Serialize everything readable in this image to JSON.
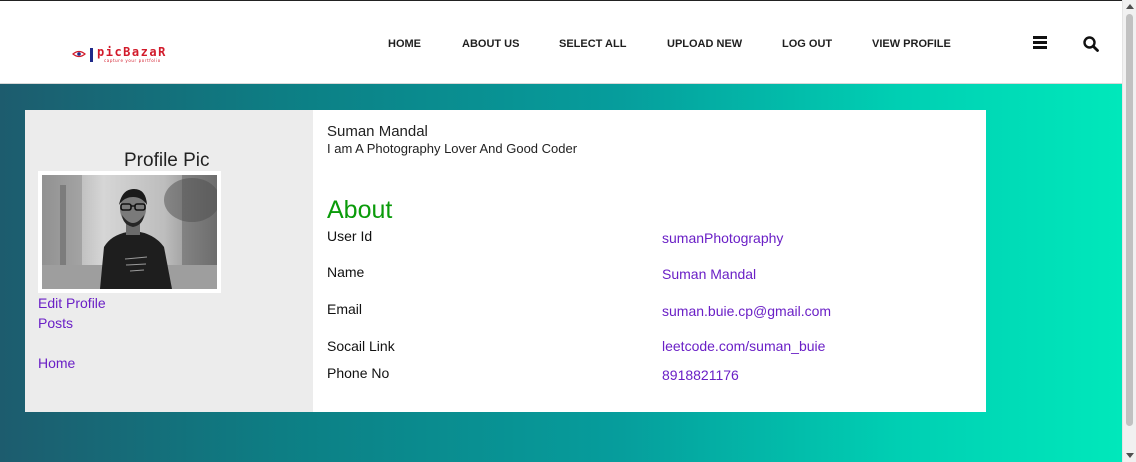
{
  "brand": {
    "logo_text": "picBazaR",
    "logo_tagline": "capture your portfolio",
    "logo_color": "#d21a2a",
    "logo_bar_color": "#1f2a8a"
  },
  "nav": {
    "items": [
      {
        "label": "HOME"
      },
      {
        "label": "ABOUT US"
      },
      {
        "label": "SELECT ALL"
      },
      {
        "label": "UPLOAD NEW"
      },
      {
        "label": "LOG OUT"
      },
      {
        "label": "VIEW PROFILE"
      }
    ],
    "menu_icon": "hamburger-menu-icon",
    "search_icon": "search-icon"
  },
  "colors": {
    "link": "#6a1fc6",
    "about_heading": "#0a9b0a",
    "gradient_start": "#1d5c6e",
    "gradient_end": "#00e8bb",
    "sidebar_bg": "#ececec"
  },
  "sidebar": {
    "title": "Profile Pic",
    "links": [
      {
        "label": "Edit Profile"
      },
      {
        "label": "Posts"
      },
      {
        "label": "Home"
      }
    ]
  },
  "profile": {
    "name": "Suman Mandal",
    "bio": "I am A Photography Lover And Good Coder"
  },
  "about": {
    "heading": "About",
    "fields": [
      {
        "label": "User Id",
        "value": "sumanPhotography"
      },
      {
        "label": "Name",
        "value": "Suman Mandal"
      },
      {
        "label": "Email",
        "value": "suman.buie.cp@gmail.com"
      },
      {
        "label": "Socail Link",
        "value": "leetcode.com/suman_buie"
      },
      {
        "label": "Phone No",
        "value": "8918821176"
      }
    ]
  }
}
